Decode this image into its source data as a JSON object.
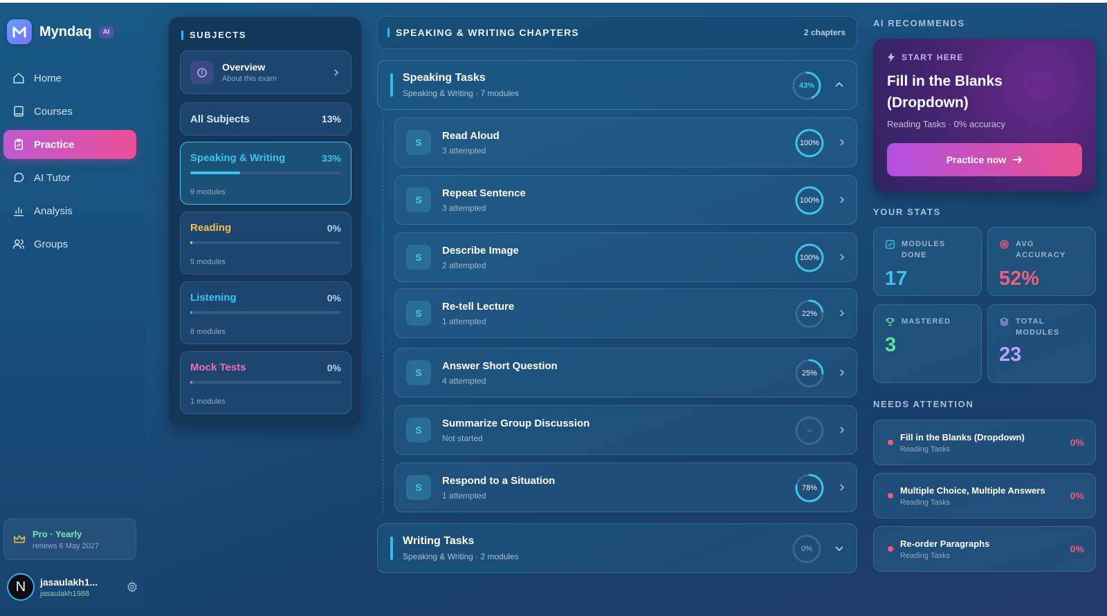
{
  "brand": {
    "name": "Myndaq",
    "badge": "AI",
    "logo_letter": "M"
  },
  "nav": [
    {
      "label": "Home",
      "icon": "home-icon",
      "active": false
    },
    {
      "label": "Courses",
      "icon": "book-icon",
      "active": false
    },
    {
      "label": "Practice",
      "icon": "clipboard-icon",
      "active": true
    },
    {
      "label": "AI Tutor",
      "icon": "chat-bubble-icon",
      "active": false
    },
    {
      "label": "Analysis",
      "icon": "bar-chart-icon",
      "active": false
    },
    {
      "label": "Groups",
      "icon": "users-icon",
      "active": false
    }
  ],
  "plan": {
    "title": "Pro · Yearly",
    "renews": "renews 6 May 2027"
  },
  "user": {
    "initial": "N",
    "name": "jasaulakh1...",
    "handle": "jasaulakh1988"
  },
  "subjects": {
    "heading": "SUBJECTS",
    "overview": {
      "title": "Overview",
      "subtitle": "About this exam"
    },
    "all": {
      "label": "All Subjects",
      "pct": "13%"
    },
    "items": [
      {
        "name": "Speaking & Writing",
        "pct": "33%",
        "progress": 0.33,
        "modules": "9 modules",
        "color": "#3ec3ea",
        "active": true
      },
      {
        "name": "Reading",
        "pct": "0%",
        "progress": 0,
        "modules": "5 modules",
        "color": "#f1c24a",
        "active": false
      },
      {
        "name": "Listening",
        "pct": "0%",
        "progress": 0,
        "modules": "8 modules",
        "color": "#3ec3ea",
        "active": false
      },
      {
        "name": "Mock Tests",
        "pct": "0%",
        "progress": 0,
        "modules": "1 modules",
        "color": "#ef6db0",
        "active": false
      }
    ]
  },
  "chapters": {
    "heading": "SPEAKING & WRITING CHAPTERS",
    "count": "2 chapters",
    "groups": [
      {
        "title": "Speaking Tasks",
        "subtitle": "Speaking & Writing · 7 modules",
        "pct_label": "43%",
        "progress": 0.43,
        "expanded": true,
        "modules": [
          {
            "badge": "S",
            "name": "Read Aloud",
            "status": "3 attempted",
            "pct_label": "100%",
            "progress": 1.0
          },
          {
            "badge": "S",
            "name": "Repeat Sentence",
            "status": "3 attempted",
            "pct_label": "100%",
            "progress": 1.0
          },
          {
            "badge": "S",
            "name": "Describe Image",
            "status": "2 attempted",
            "pct_label": "100%",
            "progress": 1.0
          },
          {
            "badge": "S",
            "name": "Re-tell Lecture",
            "status": "1 attempted",
            "pct_label": "22%",
            "progress": 0.22
          },
          {
            "badge": "S",
            "name": "Answer Short Question",
            "status": "4 attempted",
            "pct_label": "25%",
            "progress": 0.25
          },
          {
            "badge": "S",
            "name": "Summarize Group Discussion",
            "status": "Not started",
            "pct_label": "–",
            "progress": 0
          },
          {
            "badge": "S",
            "name": "Respond to a Situation",
            "status": "1 attempted",
            "pct_label": "78%",
            "progress": 0.78
          }
        ]
      },
      {
        "title": "Writing Tasks",
        "subtitle": "Speaking & Writing · 2 modules",
        "pct_label": "0%",
        "progress": 0,
        "expanded": false,
        "modules": []
      }
    ]
  },
  "recommend": {
    "heading": "AI RECOMMENDS",
    "tag": "START HERE",
    "title": "Fill in the Blanks (Dropdown)",
    "subtitle": "Reading Tasks · 0% accuracy",
    "button": "Practice now"
  },
  "stats": {
    "heading": "YOUR STATS",
    "cards": [
      {
        "label": "MODULES DONE",
        "value": "17",
        "icon": "checkbox-icon",
        "color": "#3ec3ea"
      },
      {
        "label": "AVG ACCURACY",
        "value": "52%",
        "icon": "target-icon",
        "color": "#f0607f"
      },
      {
        "label": "MASTERED",
        "value": "3",
        "icon": "trophy-icon",
        "color": "#5fe39c"
      },
      {
        "label": "TOTAL MODULES",
        "value": "23",
        "icon": "layers-icon",
        "color": "#b9a4ff"
      }
    ]
  },
  "attention": {
    "heading": "NEEDS ATTENTION",
    "items": [
      {
        "name": "Fill in the Blanks (Dropdown)",
        "category": "Reading Tasks",
        "pct": "0%"
      },
      {
        "name": "Multiple Choice, Multiple Answers",
        "category": "Reading Tasks",
        "pct": "0%"
      },
      {
        "name": "Re-order Paragraphs",
        "category": "Reading Tasks",
        "pct": "0%"
      }
    ]
  }
}
